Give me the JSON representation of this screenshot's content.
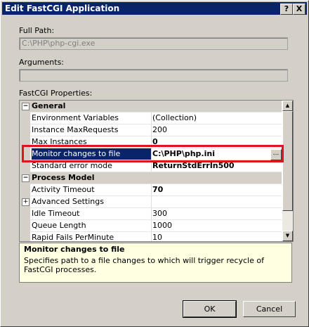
{
  "window": {
    "title": "Edit FastCGI Application",
    "help_label": "?",
    "close_label": "X"
  },
  "full_path": {
    "label": "Full Path:",
    "value": "C:\\PHP\\php-cgi.exe"
  },
  "arguments": {
    "label": "Arguments:",
    "value": ""
  },
  "properties": {
    "label": "FastCGI Properties:",
    "categories": [
      {
        "name": "General",
        "expander": "−",
        "rows": [
          {
            "name": "Environment Variables",
            "value": "(Collection)"
          },
          {
            "name": "Instance MaxRequests",
            "value": "200"
          },
          {
            "name": "Max Instances",
            "value": "0"
          },
          {
            "name": "Monitor changes to file",
            "value": "C:\\PHP\\php.ini",
            "selected": true,
            "ellipsis": "..."
          },
          {
            "name": "Standard error mode",
            "value": "ReturnStdErrIn500"
          }
        ]
      },
      {
        "name": "Process Model",
        "expander": "−",
        "rows": [
          {
            "name": "Activity Timeout",
            "value": "70"
          },
          {
            "name": "Advanced Settings",
            "value": "",
            "expander": "+"
          },
          {
            "name": "Idle Timeout",
            "value": "300"
          },
          {
            "name": "Queue Length",
            "value": "1000"
          },
          {
            "name": "Rapid Fails PerMinute",
            "value": "10"
          }
        ]
      }
    ]
  },
  "description": {
    "title": "Monitor changes to file",
    "text": "Specifies path to a file changes to which will trigger recycle of FastCGI processes."
  },
  "buttons": {
    "ok": "OK",
    "cancel": "Cancel"
  },
  "scrollbar": {
    "up_arrow": "▲",
    "down_arrow": "▼"
  },
  "colors": {
    "title_bar": "#0a246a",
    "selection": "#0a246a",
    "highlight_box": "#e0141c",
    "description_bg": "#ffffe1"
  }
}
